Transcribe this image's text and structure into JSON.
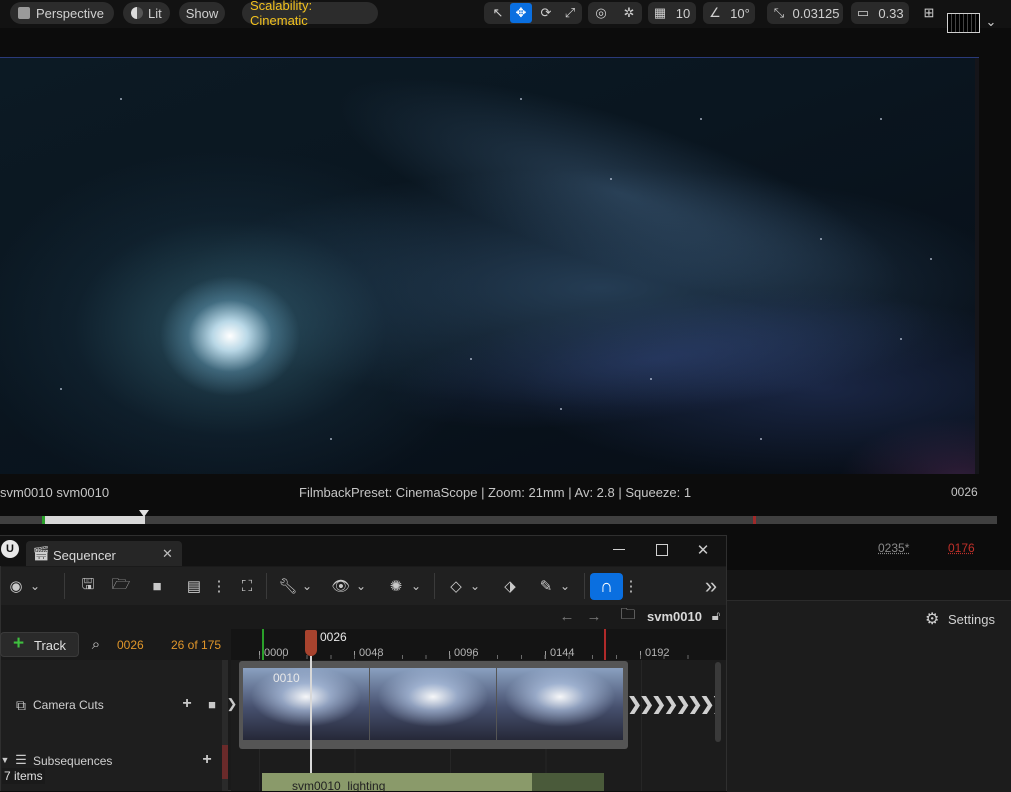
{
  "top_toolbar": {
    "perspective": "Perspective",
    "lit": "Lit",
    "show": "Show",
    "scalability": "Scalability: Cinematic",
    "grid_value": "10",
    "angle_value": "10°",
    "scale_value": "0.03125",
    "camera_speed": "0.33"
  },
  "viewport_info": {
    "left": "svm0010 svm0010",
    "center": "FilmbackPreset: CinemaScope | Zoom: 21mm | Av: 2.8 | Squeeze: 1",
    "right": "0026"
  },
  "frames_right": {
    "end_frame": "0235*",
    "red_frame": "0176"
  },
  "sequencer": {
    "tab_title": "Sequencer",
    "sequence_name": "svm0010",
    "track_button": "Track",
    "current_frame": "0026",
    "frame_count": "26 of 175",
    "playhead_label": "0026",
    "ticks": [
      "0000",
      "0048",
      "0096",
      "0144",
      "0192"
    ],
    "tracks": [
      "Camera Cuts",
      "Subsequences"
    ],
    "clip_label": "0010",
    "lighting_clip": "svm0010_lighting",
    "items_count": "7 items"
  },
  "details_panel": {
    "settings_label": "Settings"
  },
  "colors": {
    "accent": "#0a6fe0",
    "scalability": "#f2c21e",
    "frame_orange": "#e0962a",
    "red": "#c0302a"
  }
}
